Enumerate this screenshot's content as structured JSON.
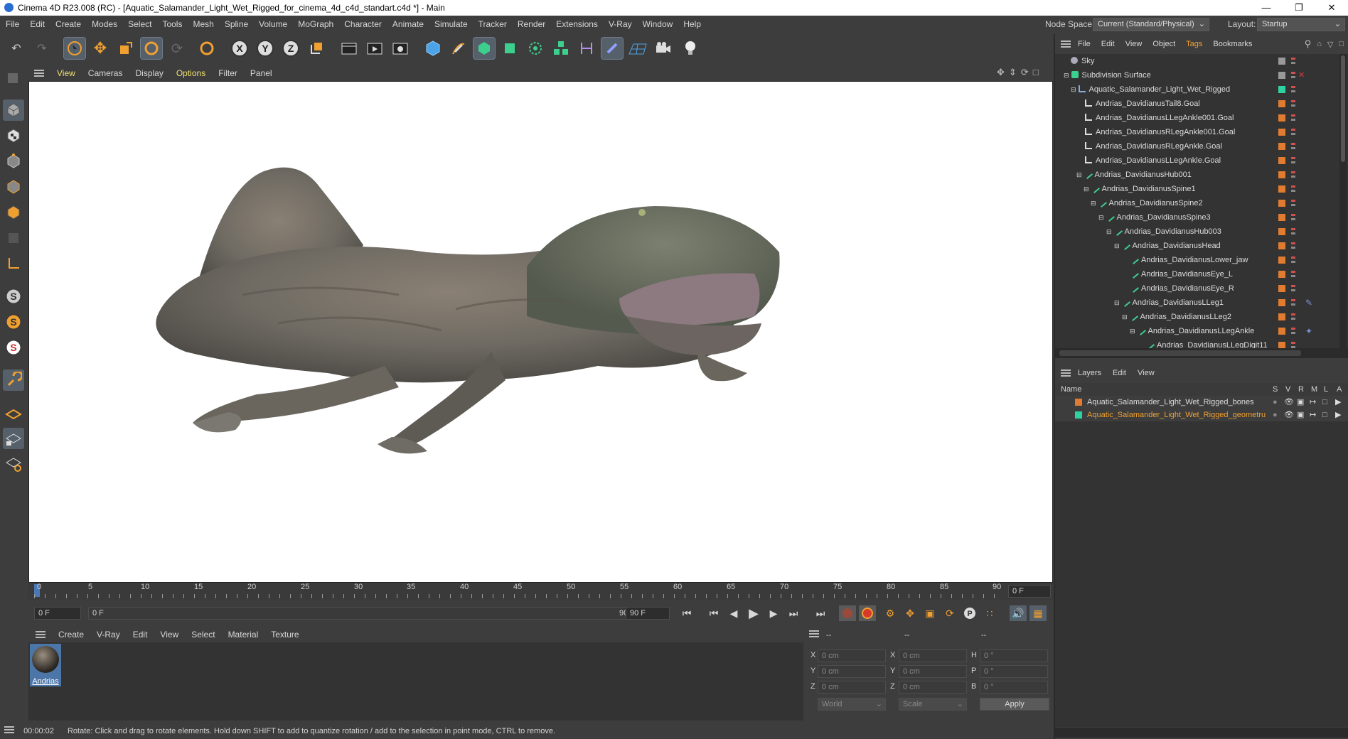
{
  "window": {
    "title": "Cinema 4D R23.008 (RC) - [Aquatic_Salamander_Light_Wet_Rigged_for_cinema_4d_c4d_standart.c4d *] - Main"
  },
  "menubar": [
    {
      "label": "File"
    },
    {
      "label": "Edit"
    },
    {
      "label": "Create"
    },
    {
      "label": "Modes"
    },
    {
      "label": "Select"
    },
    {
      "label": "Tools"
    },
    {
      "label": "Mesh"
    },
    {
      "label": "Spline"
    },
    {
      "label": "Volume"
    },
    {
      "label": "MoGraph"
    },
    {
      "label": "Character"
    },
    {
      "label": "Animate"
    },
    {
      "label": "Simulate"
    },
    {
      "label": "Tracker"
    },
    {
      "label": "Render"
    },
    {
      "label": "Extensions"
    },
    {
      "label": "V-Ray"
    },
    {
      "label": "Window"
    },
    {
      "label": "Help"
    }
  ],
  "header": {
    "node_space_label": "Node Space:",
    "node_space_value": "Current (Standard/Physical)",
    "layout_label": "Layout:",
    "layout_value": "Startup"
  },
  "viewport_menu": [
    {
      "label": "View"
    },
    {
      "label": "Cameras"
    },
    {
      "label": "Display"
    },
    {
      "label": "Options"
    },
    {
      "label": "Filter"
    },
    {
      "label": "Panel"
    }
  ],
  "timeline": {
    "ticks": [
      "0",
      "5",
      "10",
      "15",
      "20",
      "25",
      "30",
      "35",
      "40",
      "45",
      "50",
      "55",
      "60",
      "65",
      "70",
      "75",
      "80",
      "85",
      "90"
    ],
    "current_frame": "0 F"
  },
  "transport": {
    "start": "0 F",
    "range_start": "0 F",
    "range_end": "90 F",
    "end": "90 F"
  },
  "material_menu": [
    {
      "label": "Create"
    },
    {
      "label": "V-Ray"
    },
    {
      "label": "Edit"
    },
    {
      "label": "View"
    },
    {
      "label": "Select"
    },
    {
      "label": "Material"
    },
    {
      "label": "Texture"
    }
  ],
  "material": {
    "name": "Andrias"
  },
  "coords": {
    "header": [
      "--",
      "--",
      "--"
    ],
    "rows": [
      {
        "a": "X",
        "av": "0 cm",
        "b": "X",
        "bv": "0 cm",
        "c": "H",
        "cv": "0 °"
      },
      {
        "a": "Y",
        "av": "0 cm",
        "b": "Y",
        "bv": "0 cm",
        "c": "P",
        "cv": "0 °"
      },
      {
        "a": "Z",
        "av": "0 cm",
        "b": "Z",
        "bv": "0 cm",
        "c": "B",
        "cv": "0 °"
      }
    ],
    "world": "World",
    "scale": "Scale",
    "apply": "Apply"
  },
  "status": {
    "time": "00:00:02",
    "message": "Rotate: Click and drag to rotate elements. Hold down SHIFT to add to quantize rotation / add to the selection in point mode, CTRL to remove."
  },
  "object_menu": [
    {
      "label": "File"
    },
    {
      "label": "Edit"
    },
    {
      "label": "View"
    },
    {
      "label": "Object"
    },
    {
      "label": "Tags"
    },
    {
      "label": "Bookmarks"
    }
  ],
  "objects": [
    {
      "name": "Sky",
      "color": "#999999"
    },
    {
      "name": "Subdivision Surface",
      "color": "#999999"
    },
    {
      "name": "Aquatic_Salamander_Light_Wet_Rigged",
      "color": "#2dd2a0"
    },
    {
      "name": "Andrias_DavidianusTail8.Goal",
      "color": "#e07b30"
    },
    {
      "name": "Andrias_DavidianusLLegAnkle001.Goal",
      "color": "#e07b30"
    },
    {
      "name": "Andrias_DavidianusRLegAnkle001.Goal",
      "color": "#e07b30"
    },
    {
      "name": "Andrias_DavidianusRLegAnkle.Goal",
      "color": "#e07b30"
    },
    {
      "name": "Andrias_DavidianusLLegAnkle.Goal",
      "color": "#e07b30"
    },
    {
      "name": "Andrias_DavidianusHub001",
      "color": "#e07b30"
    },
    {
      "name": "Andrias_DavidianusSpine1",
      "color": "#e07b30"
    },
    {
      "name": "Andrias_DavidianusSpine2",
      "color": "#e07b30"
    },
    {
      "name": "Andrias_DavidianusSpine3",
      "color": "#e07b30"
    },
    {
      "name": "Andrias_DavidianusHub003",
      "color": "#e07b30"
    },
    {
      "name": "Andrias_DavidianusHead",
      "color": "#e07b30"
    },
    {
      "name": "Andrias_DavidianusLower_jaw",
      "color": "#e07b30"
    },
    {
      "name": "Andrias_DavidianusEye_L",
      "color": "#e07b30"
    },
    {
      "name": "Andrias_DavidianusEye_R",
      "color": "#e07b30"
    },
    {
      "name": "Andrias_DavidianusLLeg1",
      "color": "#e07b30"
    },
    {
      "name": "Andrias_DavidianusLLeg2",
      "color": "#e07b30"
    },
    {
      "name": "Andrias_DavidianusLLegAnkle",
      "color": "#e07b30"
    },
    {
      "name": "Andrias_DavidianusLLegDigit11",
      "color": "#e07b30"
    }
  ],
  "layer_menu": [
    {
      "label": "Layers"
    },
    {
      "label": "Edit"
    },
    {
      "label": "View"
    }
  ],
  "layer_header": {
    "name": "Name",
    "cols": [
      "S",
      "V",
      "R",
      "M",
      "L",
      "A"
    ]
  },
  "layers": [
    {
      "name": "Aquatic_Salamander_Light_Wet_Rigged_bones",
      "color": "#e07b30",
      "text_color": "#dcdcdc"
    },
    {
      "name": "Aquatic_Salamander_Light_Wet_Rigged_geometru",
      "color": "#2dd2a0",
      "text_color": "#f0a030"
    }
  ]
}
